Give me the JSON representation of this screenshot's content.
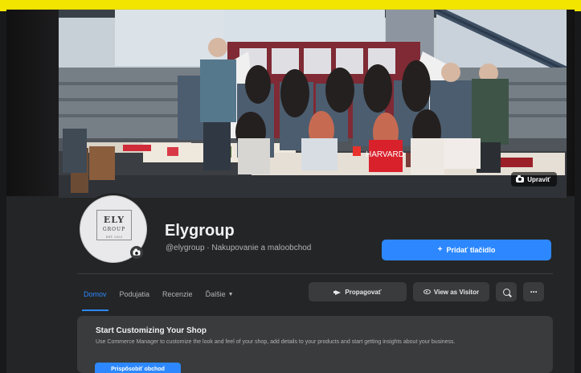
{
  "page": {
    "name": "Elygroup",
    "subtitle": "@elygroup · Nakupovanie a maloobchod"
  },
  "cover": {
    "edit_label": "Upraviť"
  },
  "logo": {
    "line1": "ELY",
    "line2": "GROUP",
    "line3": "EST. 2023"
  },
  "actions": {
    "add_button": "Pridať tlačidlo"
  },
  "tabs": [
    {
      "label": "Domov"
    },
    {
      "label": "Podujatia"
    },
    {
      "label": "Recenzie"
    },
    {
      "label": "Ďalšie"
    }
  ],
  "toolbar": {
    "promote": "Propagovať",
    "visitor": "View as Visitor"
  },
  "shop_card": {
    "title": "Start Customizing Your Shop",
    "description": "Use Commerce Manager to customize the look and feel of your shop, add details to your products and start getting insights about your business.",
    "button": "Prispôsobiť obchod"
  },
  "colors": {
    "accent": "#2d88ff",
    "background": "#18191a",
    "card": "#242526",
    "banner": "#f2e600"
  }
}
